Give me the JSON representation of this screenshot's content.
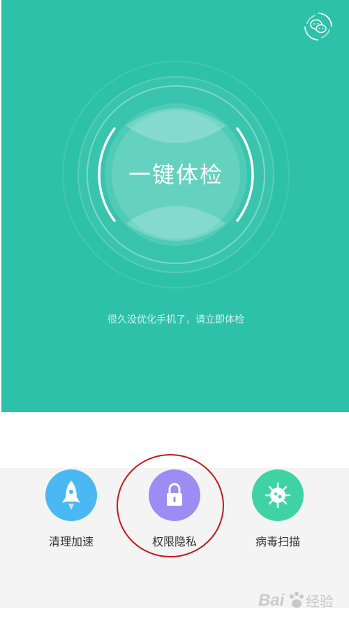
{
  "hero": {
    "check_title": "一键体检",
    "hint": "很久没优化手机了，请立即体检",
    "bg_color": "#2ec1a9",
    "top_right_icon": "wechat-icon"
  },
  "tools": [
    {
      "label": "清理加速",
      "icon": "rocket-icon",
      "color": "#4ab8f2"
    },
    {
      "label": "权限隐私",
      "icon": "lock-icon",
      "color": "#9d8cf3"
    },
    {
      "label": "病毒扫描",
      "icon": "virus-icon",
      "color": "#3fd3a4"
    }
  ],
  "annotation": {
    "highlight_color": "#c9171c"
  },
  "watermark": {
    "text": "Bai经验",
    "icon": "baidu-paw-icon"
  }
}
